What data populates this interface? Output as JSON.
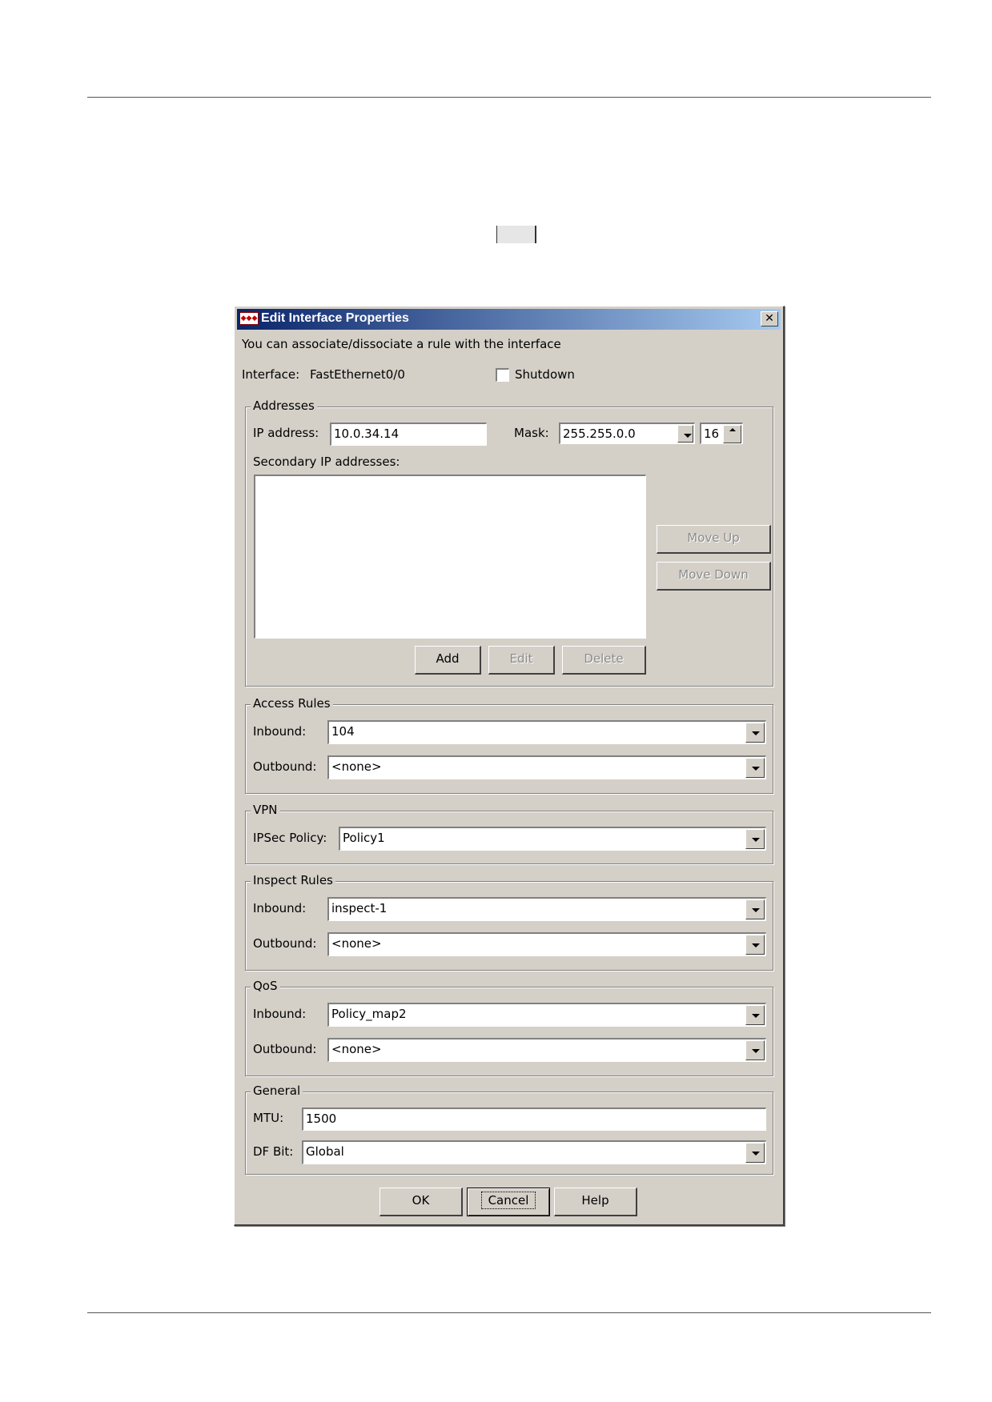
{
  "dialog": {
    "title": "Edit Interface Properties",
    "close_glyph": "✕",
    "icon_text": "◆◆◆",
    "description": "You can associate/dissociate a rule with the interface",
    "interface_label": "Interface:",
    "interface_value": "FastEthernet0/0",
    "shutdown_label": "Shutdown",
    "shutdown_checked": false
  },
  "addresses": {
    "legend": "Addresses",
    "ip_label": "IP address:",
    "ip_value": "10.0.34.14",
    "mask_label": "Mask:",
    "mask_value": "255.255.0.0",
    "prefix_value": "16",
    "secondary_label": "Secondary IP addresses:",
    "move_up": "Move Up",
    "move_down": "Move Down",
    "add": "Add",
    "edit": "Edit",
    "delete": "Delete"
  },
  "access_rules": {
    "legend": "Access Rules",
    "inbound_label": "Inbound:",
    "inbound_value": "104",
    "outbound_label": "Outbound:",
    "outbound_value": "<none>"
  },
  "vpn": {
    "legend": "VPN",
    "ipsec_label": "IPSec Policy:",
    "ipsec_value": "Policy1"
  },
  "inspect_rules": {
    "legend": "Inspect Rules",
    "inbound_label": "Inbound:",
    "inbound_value": "inspect-1",
    "outbound_label": "Outbound:",
    "outbound_value": "<none>"
  },
  "qos": {
    "legend": "QoS",
    "inbound_label": "Inbound:",
    "inbound_value": "Policy_map2",
    "outbound_label": "Outbound:",
    "outbound_value": "<none>"
  },
  "general": {
    "legend": "General",
    "mtu_label": "MTU:",
    "mtu_value": "1500",
    "df_label": "DF Bit:",
    "df_value": "Global"
  },
  "footer": {
    "ok": "OK",
    "cancel": "Cancel",
    "help": "Help"
  },
  "colors": {
    "dialog_bg": "#d4d0c8",
    "title_start": "#0a246a",
    "title_end": "#a6caf0"
  }
}
